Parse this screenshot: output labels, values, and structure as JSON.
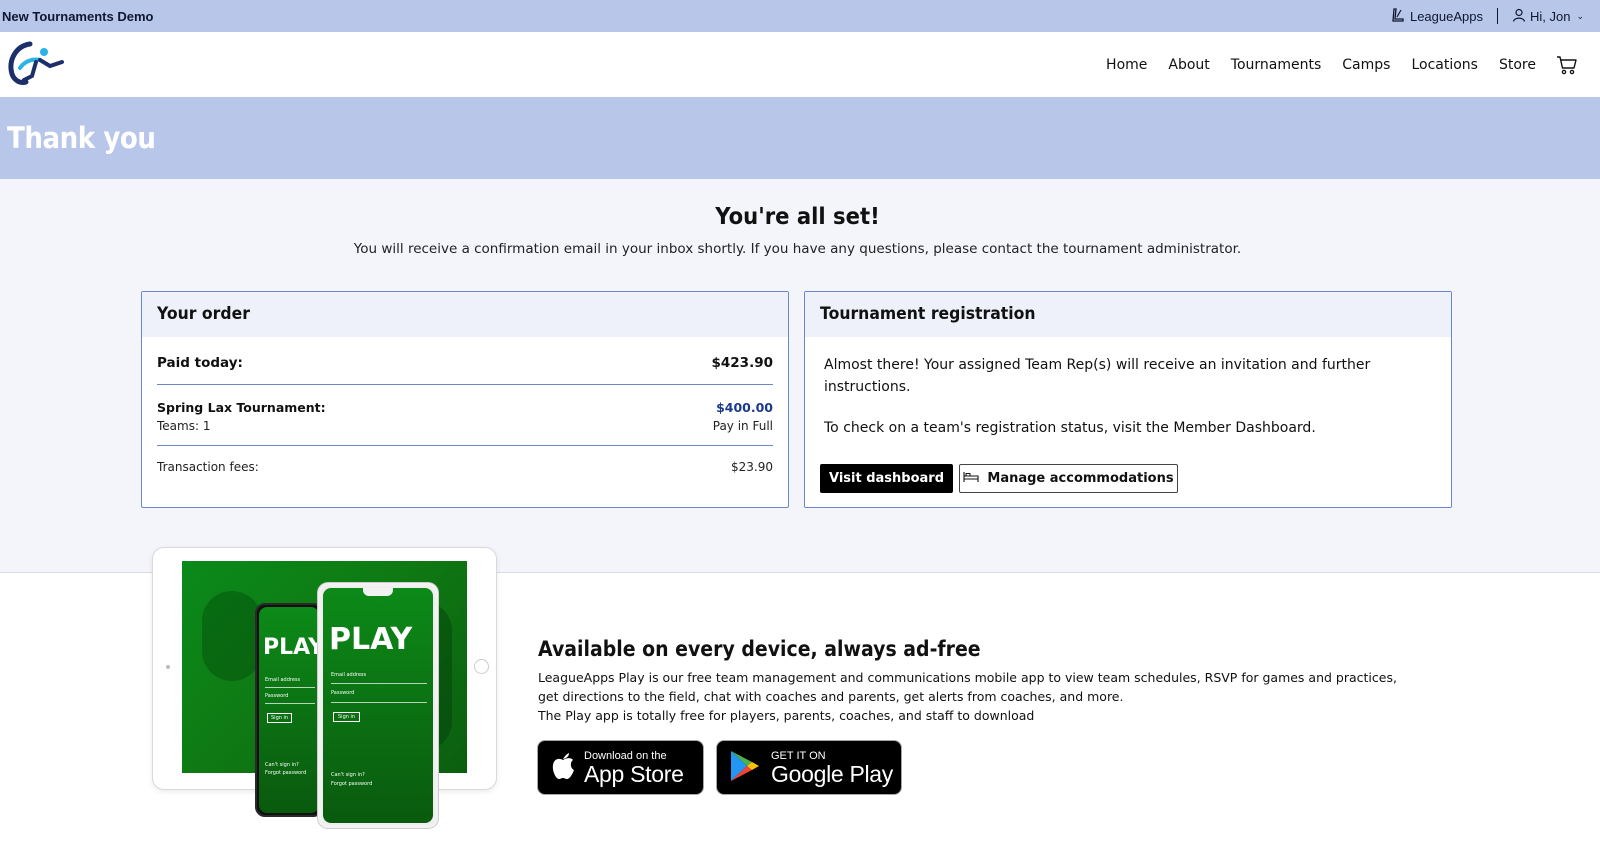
{
  "topbar": {
    "org_name": "New Tournaments Demo",
    "leagueapps_label": "LeagueApps",
    "greeting": "Hi, Jon"
  },
  "nav": {
    "items": [
      "Home",
      "About",
      "Tournaments",
      "Camps",
      "Locations",
      "Store"
    ],
    "cart_icon": "cart-icon"
  },
  "hero": {
    "title": "Thank you"
  },
  "confirmation": {
    "heading": "You're all set!",
    "message": "You will receive a confirmation email in your inbox shortly. If you have any questions, please contact the tournament administrator."
  },
  "order": {
    "title": "Your order",
    "paid_label": "Paid today:",
    "paid_amount": "$423.90",
    "item_name": "Spring Lax Tournament:",
    "item_sub": "Teams: 1",
    "item_amount": "$400.00",
    "item_payment": "Pay in Full",
    "fees_label": "Transaction fees:",
    "fees_amount": "$23.90"
  },
  "registration": {
    "title": "Tournament registration",
    "message1": "Almost there! Your assigned Team Rep(s) will receive an invitation and further instructions.",
    "message2": "To check on a team's registration status, visit the Member Dashboard.",
    "dashboard_button": "Visit dashboard",
    "accommodations_button": "Manage accommodations"
  },
  "app_promo": {
    "title": "Available on every device, always ad-free",
    "description1": "LeagueApps Play is our free team management and communications mobile app to view team schedules, RSVP for games and practices, get directions to the field, chat with coaches and parents, get alerts from coaches, and more.",
    "description2": "The Play app is totally free for players, parents, coaches, and staff to download",
    "phone_brand": "PLAY",
    "phone_email_label": "Email address",
    "phone_password_label": "Password",
    "phone_signin": "Sign in",
    "phone_cant_sign_in": "Can't sign in?",
    "phone_forgot": "Forgot password",
    "app_store_small": "Download on the",
    "app_store_big": "App Store",
    "google_small": "GET IT ON",
    "google_big": "Google Play"
  },
  "colors": {
    "accent_band": "#b8c6e9",
    "card_border": "#6c86c8",
    "price_blue": "#1a3a8c",
    "promo_green": "#0b7a14"
  }
}
